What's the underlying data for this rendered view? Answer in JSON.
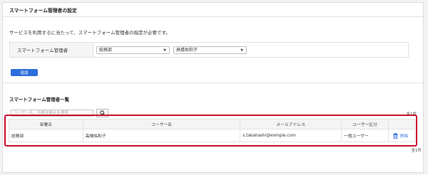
{
  "section": {
    "title": "スマートフォーム管理者の設定",
    "intro": "サービスを利用するに当たって、スマートフォーム管理者の指定が必要です。"
  },
  "form": {
    "label": "スマートフォーム管理者",
    "department_select": "総務部",
    "user_select": "高橋佑和子"
  },
  "buttons": {
    "add": "追加"
  },
  "list": {
    "title": "スマートフォーム管理者一覧",
    "search_placeholder": "ユーザー名、所属部署名を検索",
    "count_top": "全1件",
    "count_bottom": "全1件",
    "columns": [
      "部署名",
      "ユーザー名",
      "メールアドレス",
      "ユーザー区分",
      ""
    ],
    "rows": [
      {
        "department": "総務部",
        "user": "高橋佑和子",
        "email": "s.takahashi@exmple.com",
        "type": "一般ユーザー",
        "action": "削除"
      }
    ]
  },
  "colors": {
    "accent": "#2f6fdb",
    "highlight": "#c8102e"
  }
}
